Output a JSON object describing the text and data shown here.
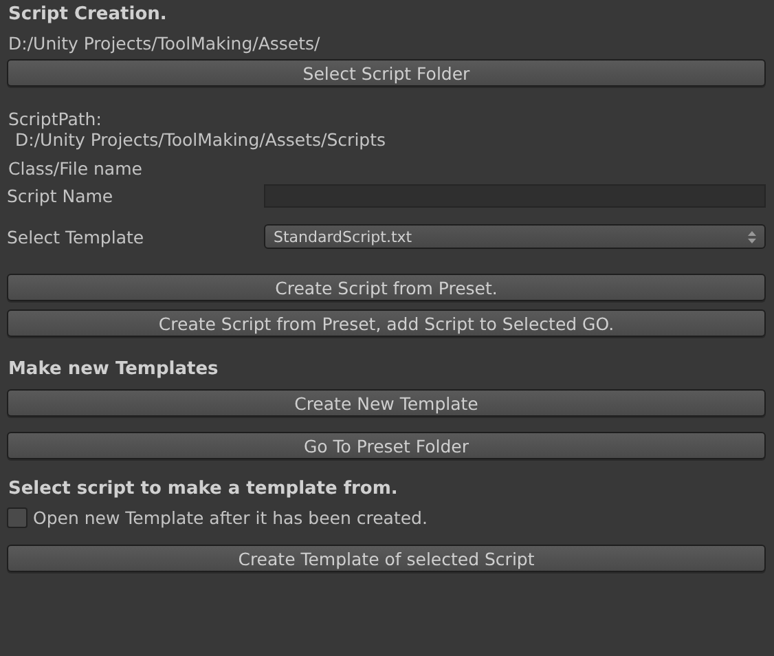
{
  "script_creation": {
    "heading": "Script Creation.",
    "folder_path": "D:/Unity Projects/ToolMaking/Assets/",
    "select_folder_button": "Select Script Folder",
    "script_path_label": "ScriptPath:",
    "script_path": "D:/Unity Projects/ToolMaking/Assets/Scripts",
    "class_file_label": "Class/File name",
    "script_name": {
      "label": "Script Name"
    },
    "select_template": {
      "label": "Select Template",
      "value": "StandardScript.txt"
    },
    "create_buttons": [
      "Create Script from Preset.",
      "Create Script from Preset, add Script to Selected GO."
    ]
  },
  "make_templates": {
    "heading": "Make new Templates",
    "buttons": [
      "Create New Template",
      "Go To Preset Folder"
    ]
  },
  "from_script": {
    "heading": "Select script to make a template from.",
    "open_after_create": {
      "label": "Open new Template after it has been created.",
      "checked": false
    },
    "button": "Create Template of selected Script"
  }
}
